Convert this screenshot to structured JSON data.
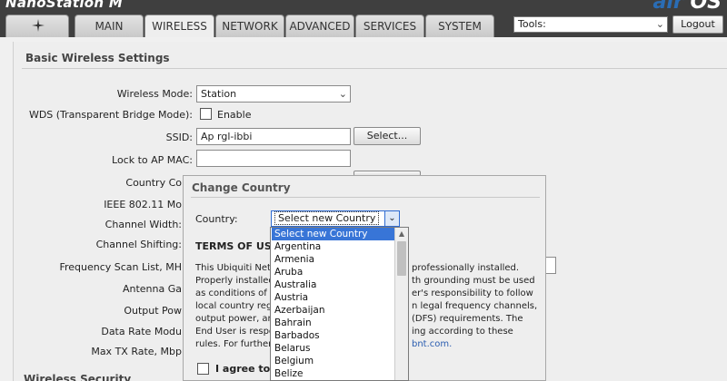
{
  "brand": {
    "left": "NanoStation M",
    "right_prefix": "air",
    "right_suffix": "OS"
  },
  "tabs": [
    {
      "label": ""
    },
    {
      "label": "MAIN"
    },
    {
      "label": "WIRELESS"
    },
    {
      "label": "NETWORK"
    },
    {
      "label": "ADVANCED"
    },
    {
      "label": "SERVICES"
    },
    {
      "label": "SYSTEM"
    }
  ],
  "tools": {
    "value": "Tools:"
  },
  "logout_label": "Logout",
  "section_title": "Basic Wireless Settings",
  "form": {
    "wireless_mode_label": "Wireless Mode:",
    "wireless_mode_value": "Station",
    "wds_label": "WDS (Transparent Bridge Mode):",
    "wds_enable_label": "Enable",
    "ssid_label": "SSID:",
    "ssid_value": "Ap rgl-ibbi",
    "select_button": "Select...",
    "lock_ap_label": "Lock to AP MAC:",
    "lock_ap_value": "",
    "country_code_label": "Country Co",
    "ieee_label": "IEEE 802.11 Mo",
    "channel_width_label": "Channel Width:",
    "channel_shifting_label": "Channel Shifting:",
    "freq_scan_label": "Frequency Scan List, MH",
    "antenna_gain_label": "Antenna Ga",
    "output_power_label": "Output Pow",
    "data_rate_label": "Data Rate Modu",
    "max_tx_label": "Max TX Rate, Mbp"
  },
  "bottom_section_title": "Wireless Security",
  "dialog": {
    "title": "Change Country",
    "country_label": "Country:",
    "country_value": "Select new Country",
    "terms_title": "TERMS OF USE",
    "terms_left": [
      "This Ubiquiti Netw",
      "Properly installed",
      "as conditions of p",
      "local country regu",
      "output power, an",
      "End User is respo",
      "rules. For further"
    ],
    "terms_right": [
      "professionally installed.",
      "th grounding must be used",
      "er's responsibility to follow",
      "n legal frequency channels,",
      "(DFS) requirements. The",
      "ing according to these",
      "bnt.com."
    ],
    "agree_label": "I agree to t"
  },
  "dropdown": {
    "items": [
      "Select new Country",
      "Argentina",
      "Armenia",
      "Aruba",
      "Australia",
      "Austria",
      "Azerbaijan",
      "Bahrain",
      "Barbados",
      "Belarus",
      "Belgium",
      "Belize"
    ]
  }
}
